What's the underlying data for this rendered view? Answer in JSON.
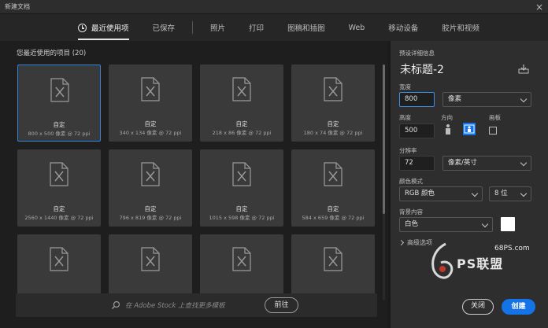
{
  "window": {
    "title": "新建文档",
    "close_label": "×"
  },
  "tabs": [
    {
      "label": "最近使用项",
      "active": true
    },
    {
      "label": "已保存",
      "active": false
    },
    {
      "label": "照片",
      "active": false
    },
    {
      "label": "打印",
      "active": false
    },
    {
      "label": "图稿和插图",
      "active": false
    },
    {
      "label": "Web",
      "active": false
    },
    {
      "label": "移动设备",
      "active": false
    },
    {
      "label": "胶片和视频",
      "active": false
    }
  ],
  "recent": {
    "title": "您最近使用的项目",
    "count": "(20)",
    "items": [
      {
        "name": "自定",
        "size": "800 x 500 像素 @ 72 ppi",
        "selected": true
      },
      {
        "name": "自定",
        "size": "340 x 134 像素 @ 72 ppi"
      },
      {
        "name": "自定",
        "size": "218 x 86 像素 @ 72 ppi"
      },
      {
        "name": "自定",
        "size": "180 x 74 像素 @ 72 ppi"
      },
      {
        "name": "自定",
        "size": "2560 x 1440 像素 @ 72 ppi"
      },
      {
        "name": "自定",
        "size": "796 x 819 像素 @ 72 ppi"
      },
      {
        "name": "自定",
        "size": "1015 x 598 像素 @ 72 ppi"
      },
      {
        "name": "自定",
        "size": "584 x 659 像素 @ 72 ppi"
      },
      {
        "name": "",
        "size": ""
      },
      {
        "name": "",
        "size": ""
      },
      {
        "name": "",
        "size": ""
      },
      {
        "name": "",
        "size": ""
      }
    ]
  },
  "search": {
    "placeholder": "在 Adobe Stock 上查找更多模板",
    "go_label": "前往"
  },
  "preset": {
    "header": "预设详细信息",
    "name": "未标题-2",
    "width_label": "宽度",
    "width_value": "800",
    "width_unit": "像素",
    "height_label": "高度",
    "height_value": "500",
    "orientation_label": "方向",
    "artboard_label": "画板",
    "resolution_label": "分辨率",
    "resolution_value": "72",
    "resolution_unit": "像素/英寸",
    "color_mode_label": "颜色模式",
    "color_mode_value": "RGB 颜色",
    "bit_depth_value": "8 位",
    "background_label": "背景内容",
    "background_value": "白色",
    "background_color": "#ffffff",
    "advanced_label": "高级选项"
  },
  "watermark": {
    "site": "68PS.com",
    "brand": "PS联盟"
  },
  "actions": {
    "close_label": "关闭",
    "create_label": "创建"
  },
  "colors": {
    "accent": "#1473e6",
    "selection": "#2f83d6"
  }
}
